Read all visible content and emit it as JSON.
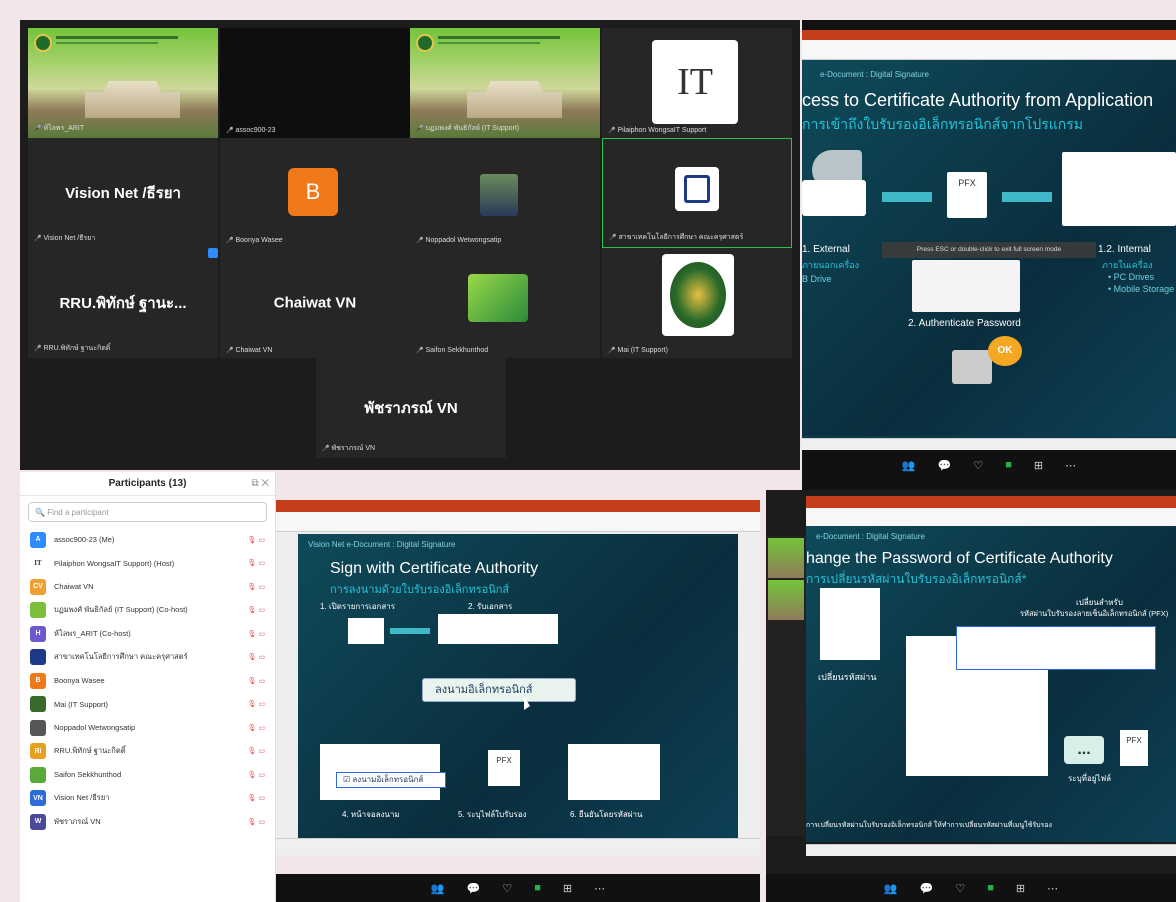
{
  "gallery": {
    "tiles": [
      {
        "name": "ห้ไลพร_ARIT",
        "big": ""
      },
      {
        "name": "assoc900-23",
        "big": ""
      },
      {
        "name": "บฏมพงศ์ พันธิกัลย์ (IT Support)",
        "big": ""
      },
      {
        "name": "Pilaiphon WongsaIT Support",
        "big": ""
      },
      {
        "name": "Vision Net /ธีรยา",
        "big": "Vision Net /ธีรยา"
      },
      {
        "name": "Boonya Wasee",
        "big": ""
      },
      {
        "name": "Noppadol Wetwongsatip",
        "big": ""
      },
      {
        "name": "สาขาเทคโนโลยีการศึกษา คณะครุศาสตร์",
        "big": ""
      },
      {
        "name": "RRU.พิทักษ์ ฐานะกิตติ์",
        "big": "RRU.พิทักษ์ ฐานะ..."
      },
      {
        "name": "Chaiwat VN",
        "big": "Chaiwat VN"
      },
      {
        "name": "Saifon Sekkhunthod",
        "big": ""
      },
      {
        "name": "Mai (IT Support)",
        "big": ""
      },
      {
        "name": "พัชราภรณ์ VN",
        "big": "พัชราภรณ์ VN"
      }
    ],
    "boonya_initial": "B",
    "it_logo": "IT"
  },
  "slide_top": {
    "sub": "e-Document : Digital Signature",
    "title": "cess to Certificate Authority from Application",
    "thai": "การเข้าถึงใบรับรองอิเล็กทรอนิกส์จากโปรแกรม",
    "external": "1. External",
    "external_thai": "ภายนอกเครื่อง",
    "drive": "B Drive",
    "internal": "1.2. Internal",
    "internal_thai": "ภายในเครื่อง",
    "pc": "• PC Drives",
    "mobile": "• Mobile Storage",
    "auth": "2. Authenticate Password",
    "ok": "OK",
    "pfx": "PFX",
    "esc": "Press ESC or double-click to exit full screen mode"
  },
  "slide_left": {
    "sub": "Vision Net  e-Document : Digital Signature",
    "title": "Sign with Certificate Authority",
    "thai": "การลงนามด้วยใบรับรองอิเล็กทรอนิกส์",
    "step1": "1. เปิดรายการเอกสาร",
    "step2": "2. รับเอกสาร",
    "sign": "ลงนามอิเล็กทรอนิกส์",
    "step4": "4. หน้าจอลงนาม",
    "step5": "5. ระบุไฟล์ใบรับรอง",
    "step6": "6. ยืนยันโดยรหัสผ่าน",
    "pfx": "PFX"
  },
  "slide_right": {
    "sub": "e-Document : Digital Signature",
    "title": "hange the Password of Certificate Authority",
    "thai": "การเปลี่ยนรหัสผ่านใบรับรองอิเล็กทรอนิกส์*",
    "label1": "เปลี่ยนสำหรับ",
    "label2": "รหัสผ่านใบรับรองลายเซ็นอิเล็กทรอนิกส์ (PFX)",
    "change": "เปลี่ยนรหัสผ่าน",
    "choose": "ระบุที่อยู่ไฟล์",
    "footer": "การเปลี่ยนรหัสผ่านใบรับรองอิเล็กทรอนิกส์ ให้ทำการเปลี่ยนรหัสผ่านที่เมนูใช้รับรอง",
    "pfx": "PFX",
    "dots": "..."
  },
  "participants": {
    "title": "Participants (13)",
    "search_placeholder": "Find a participant",
    "list": [
      {
        "init": "A",
        "color": "#2d8cff",
        "name": "assoc900-23 (Me)"
      },
      {
        "init": "IT",
        "color": "#ffffff",
        "name": "Pilaiphon WongsaIT Support) (Host)"
      },
      {
        "init": "CV",
        "color": "#f0a030",
        "name": "Chaiwat VN"
      },
      {
        "init": "",
        "color": "#7cbf3a",
        "name": "บฏมพงศ์ พันธิกัลย์ (IT Support) (Co-host)"
      },
      {
        "init": "H",
        "color": "#6a5acd",
        "name": "ห้ไลพร_ARIT (Co-host)"
      },
      {
        "init": "",
        "color": "#1d3a8a",
        "name": "สาขาเทคโนโลยีการศึกษา คณะครุศาสตร์"
      },
      {
        "init": "B",
        "color": "#f07a1a",
        "name": "Boonya Wasee"
      },
      {
        "init": "",
        "color": "#3a6a2a",
        "name": "Mai (IT Support)"
      },
      {
        "init": "",
        "color": "#555555",
        "name": "Noppadol Wetwongsatip"
      },
      {
        "init": "Ri",
        "color": "#e8a020",
        "name": "RRU.พิทักษ์ ฐานะกิตติ์"
      },
      {
        "init": "",
        "color": "#5aaa3a",
        "name": "Saifon Sekkhunthod"
      },
      {
        "init": "VN",
        "color": "#2d6bd8",
        "name": "Vision Net /ธีรยา"
      },
      {
        "init": "W",
        "color": "#4a4a9a",
        "name": "พัชราภรณ์ VN"
      }
    ]
  },
  "toolbar": [
    "Participants",
    "Chat",
    "React",
    "Share",
    "Apps",
    "More"
  ],
  "accent": "#2d8cff"
}
